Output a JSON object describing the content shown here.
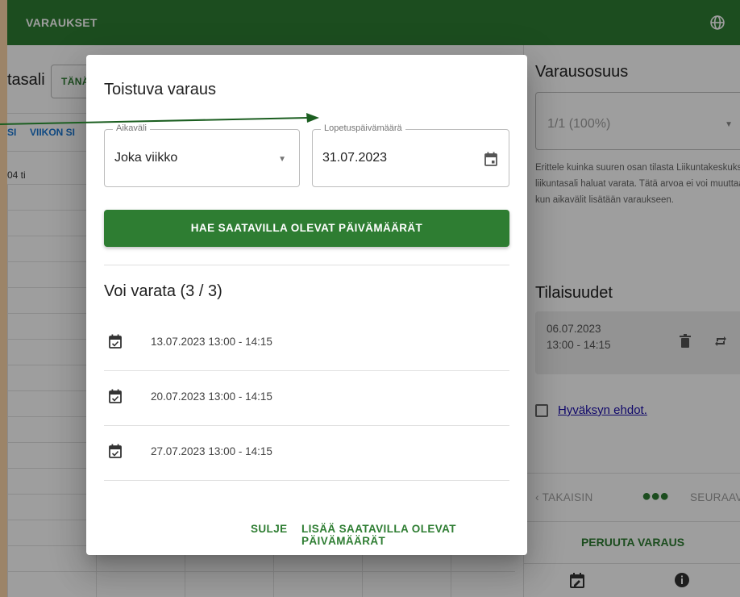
{
  "topbar": {
    "brand": "VARAUKSET",
    "globe_icon": "globe-icon"
  },
  "background": {
    "title": "tasali",
    "today_button": "TÄNÄ",
    "tabs": [
      "SI",
      "VIIKON SI"
    ],
    "day_label": "04 ti"
  },
  "sidepanel": {
    "share_heading": "Varausosuus",
    "share_value": "1/1 (100%)",
    "share_help": "Erittele kuinka suuren osan tilasta Liikuntakeskuksen liikuntasali haluat varata. Tätä arvoa ei voi muuttaa, kun aikavälit lisätään varaukseen.",
    "occurrences_heading": "Tilaisuudet",
    "occurrence": {
      "date": "06.07.2023",
      "time": "13:00 - 14:15",
      "delete_icon": "trash-icon",
      "repeat_icon": "repeat-icon"
    },
    "terms_label": "Hyväksyn ehdot.",
    "back_label": "TAKAISIN",
    "next_label": "SEURAAVA",
    "steps_dots": "●●●",
    "cancel_label": "PERUUTA VARAUS",
    "bottom_icons": [
      "calendar-edit-icon",
      "info-icon"
    ]
  },
  "dialog": {
    "title": "Toistuva varaus",
    "interval": {
      "label": "Aikaväli",
      "value": "Joka viikko"
    },
    "end_date": {
      "label": "Lopetuspäivämäärä",
      "value": "31.07.2023"
    },
    "fetch_button": "HAE SAATAVILLA OLEVAT PÄIVÄMÄÄRÄT",
    "available_title": "Voi varata (3 / 3)",
    "slots": [
      "13.07.2023 13:00 - 14:15",
      "20.07.2023 13:00 - 14:15",
      "27.07.2023 13:00 - 14:15"
    ],
    "close_button": "SULJE",
    "add_button": "LISÄÄ SAATAVILLA OLEVAT PÄIVÄMÄÄRÄT"
  },
  "colors": {
    "primary": "#2e7d32",
    "page_margin": "#fcd5a8",
    "link": "#1a0dab",
    "annotation_arrow": "#1b5e20"
  }
}
